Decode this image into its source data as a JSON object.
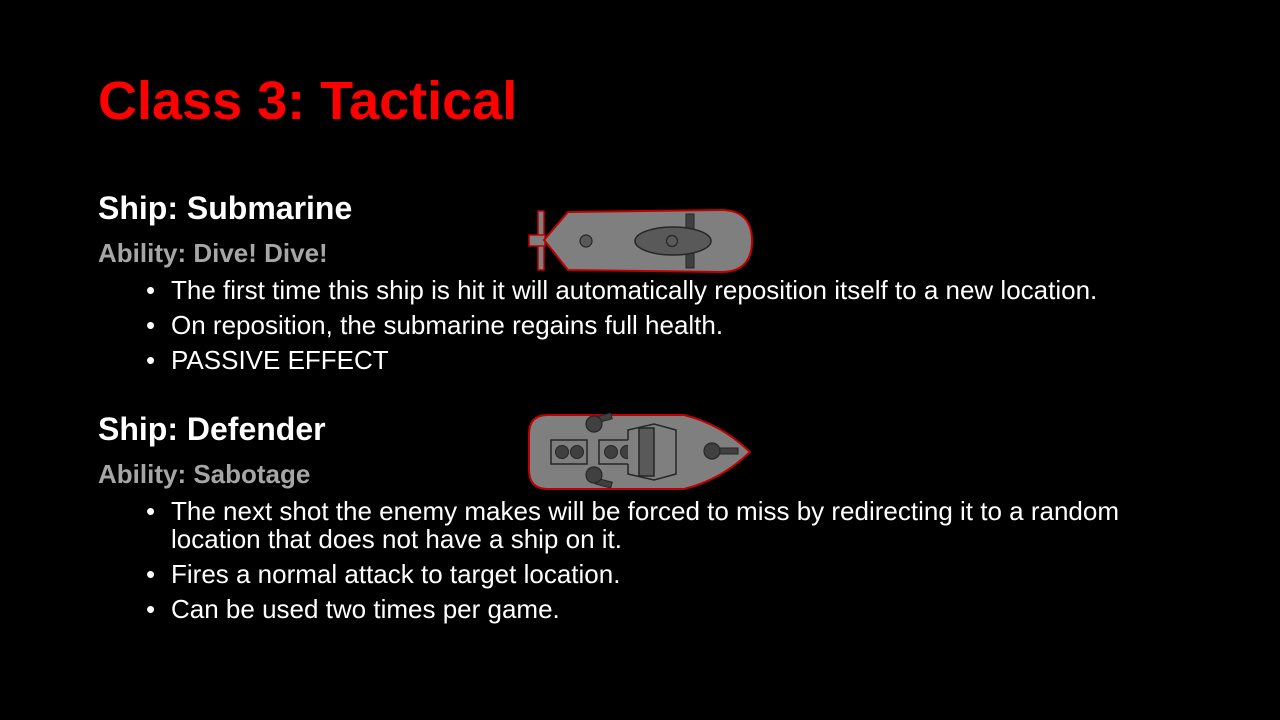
{
  "slide": {
    "title": "Class 3: Tactical",
    "title_color": "#ff0000"
  },
  "ships": [
    {
      "heading": "Ship: Submarine",
      "ability": "Ability: Dive! Dive!",
      "bullets": [
        "The first time this ship is hit it will automatically reposition itself to a new location.",
        "On reposition, the submarine regains full health.",
        "PASSIVE EFFECT"
      ],
      "icon": "submarine-icon"
    },
    {
      "heading": "Ship: Defender",
      "ability": "Ability: Sabotage",
      "bullets": [
        "The next shot the enemy makes will be forced to miss by redirecting it to a random location that does not have a ship on it.",
        "Fires a normal attack to target location.",
        "Can be used two times per game."
      ],
      "icon": "defender-ship-icon"
    }
  ],
  "colors": {
    "background": "#000000",
    "ability_text": "#a6a6a6",
    "ship_hull": "#7f7f7f",
    "ship_outline": "#c00000"
  }
}
